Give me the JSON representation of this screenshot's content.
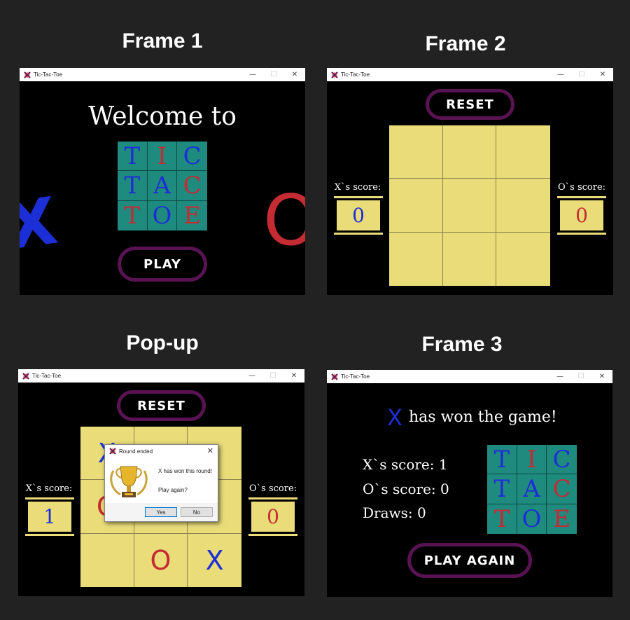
{
  "app": {
    "window_title": "Tic-Tac-Toe"
  },
  "titles": {
    "frame1": "Frame 1",
    "frame2": "Frame 2",
    "popup": "Pop-up",
    "frame3": "Frame 3"
  },
  "window_controls": {
    "minimize": "—",
    "maximize": "☐",
    "close": "✕"
  },
  "frame1": {
    "welcome": "Welcome to",
    "logo": [
      "T",
      "I",
      "C",
      "T",
      "A",
      "C",
      "T",
      "O",
      "E"
    ],
    "big_x": "X",
    "big_o": "O",
    "play_button": "PLAY"
  },
  "frame2": {
    "reset_button": "RESET",
    "x_score_label": "X`s score:",
    "o_score_label": "O`s score:",
    "x_score": "0",
    "o_score": "0",
    "board": [
      "",
      "",
      "",
      "",
      "",
      "",
      "",
      "",
      ""
    ]
  },
  "popup": {
    "reset_button": "RESET",
    "x_score_label": "X`s score:",
    "o_score_label": "O`s score:",
    "x_score": "1",
    "o_score": "0",
    "board": [
      "X",
      "",
      "",
      "O",
      "",
      "",
      "",
      "O",
      "X"
    ],
    "dialog": {
      "title": "Round ended",
      "message": "X has won this round!",
      "question": "Play again?",
      "yes": "Yes",
      "no": "No",
      "close": "✕",
      "icon": "trophy-icon"
    }
  },
  "frame3": {
    "winner": "X",
    "won_text": "has won the game!",
    "x_score_line": "X`s score:  1",
    "o_score_line": "O`s score:  0",
    "draws_line": "Draws:  0",
    "logo": [
      "T",
      "I",
      "C",
      "T",
      "A",
      "C",
      "T",
      "O",
      "E"
    ],
    "play_again_button": "PLAY AGAIN"
  },
  "colors": {
    "x_color": "#1c2fd6",
    "o_color": "#c52b33",
    "board": "#e9dc79",
    "logo_bg": "#1f8a7e",
    "button_border": "#5a1352"
  }
}
